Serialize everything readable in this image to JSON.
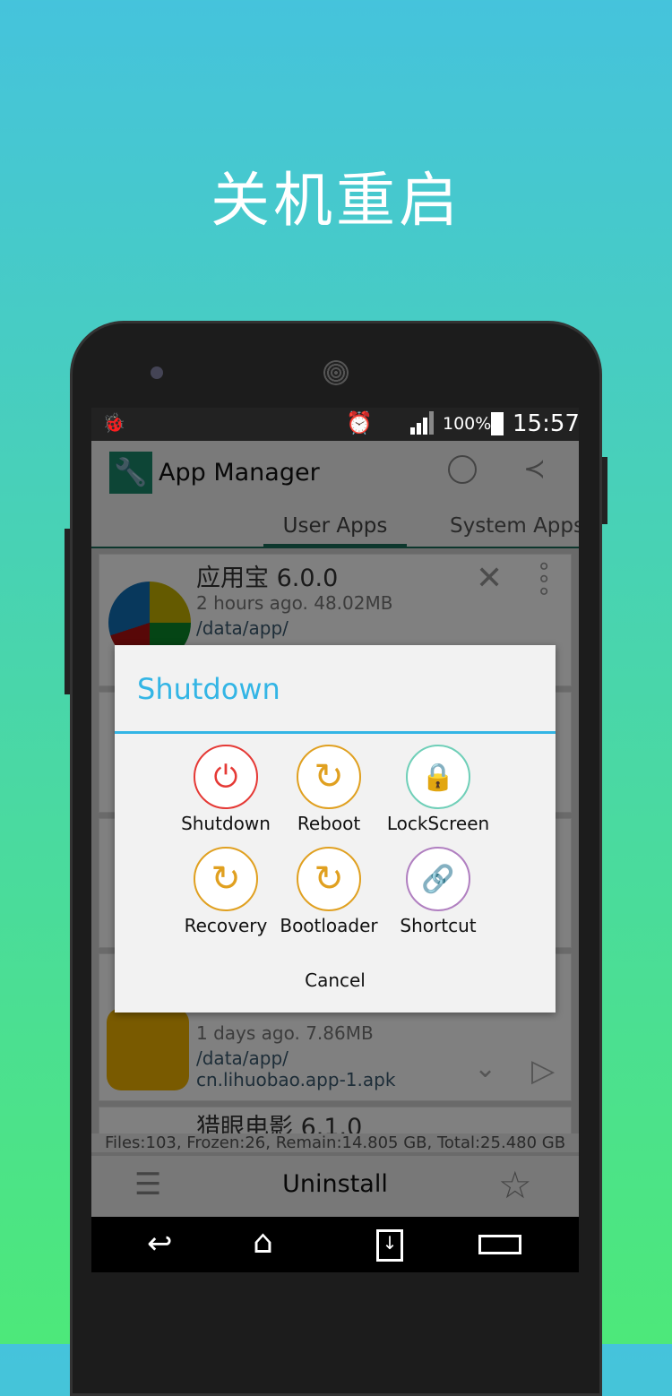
{
  "headline": "关机重启",
  "status": {
    "battery": "100%",
    "time": "15:57"
  },
  "app": {
    "title": "App Manager"
  },
  "tabs": [
    {
      "label": "User Apps",
      "active": true
    },
    {
      "label": "System Apps"
    }
  ],
  "apps": [
    {
      "name": "应用宝 6.0.0",
      "meta": "2 hours ago. 48.02MB",
      "path": "/data/app/"
    },
    {
      "name": "",
      "meta": "1 days ago. 7.86MB",
      "path": "/data/app/",
      "apk": "cn.lihuobao.app-1.apk"
    },
    {
      "name": "猎眼电影 6.1.0"
    }
  ],
  "footer": {
    "stats": "Files:103, Frozen:26, Remain:14.805 GB, Total:25.480 GB",
    "uninstall": "Uninstall"
  },
  "dialog": {
    "title": "Shutdown",
    "options": [
      {
        "label": "Shutdown",
        "icon": "power-icon",
        "color": "#e53935"
      },
      {
        "label": "Reboot",
        "icon": "refresh-icon",
        "color": "#e0a020"
      },
      {
        "label": "LockScreen",
        "icon": "lock-icon",
        "color": "#6fcfb8"
      },
      {
        "label": "Recovery",
        "icon": "refresh-icon",
        "color": "#e0a020"
      },
      {
        "label": "Bootloader",
        "icon": "refresh-icon",
        "color": "#e0a020"
      },
      {
        "label": "Shortcut",
        "icon": "link-icon",
        "color": "#b07fc0"
      }
    ],
    "cancel": "Cancel",
    "accent": "#33b5e5"
  }
}
